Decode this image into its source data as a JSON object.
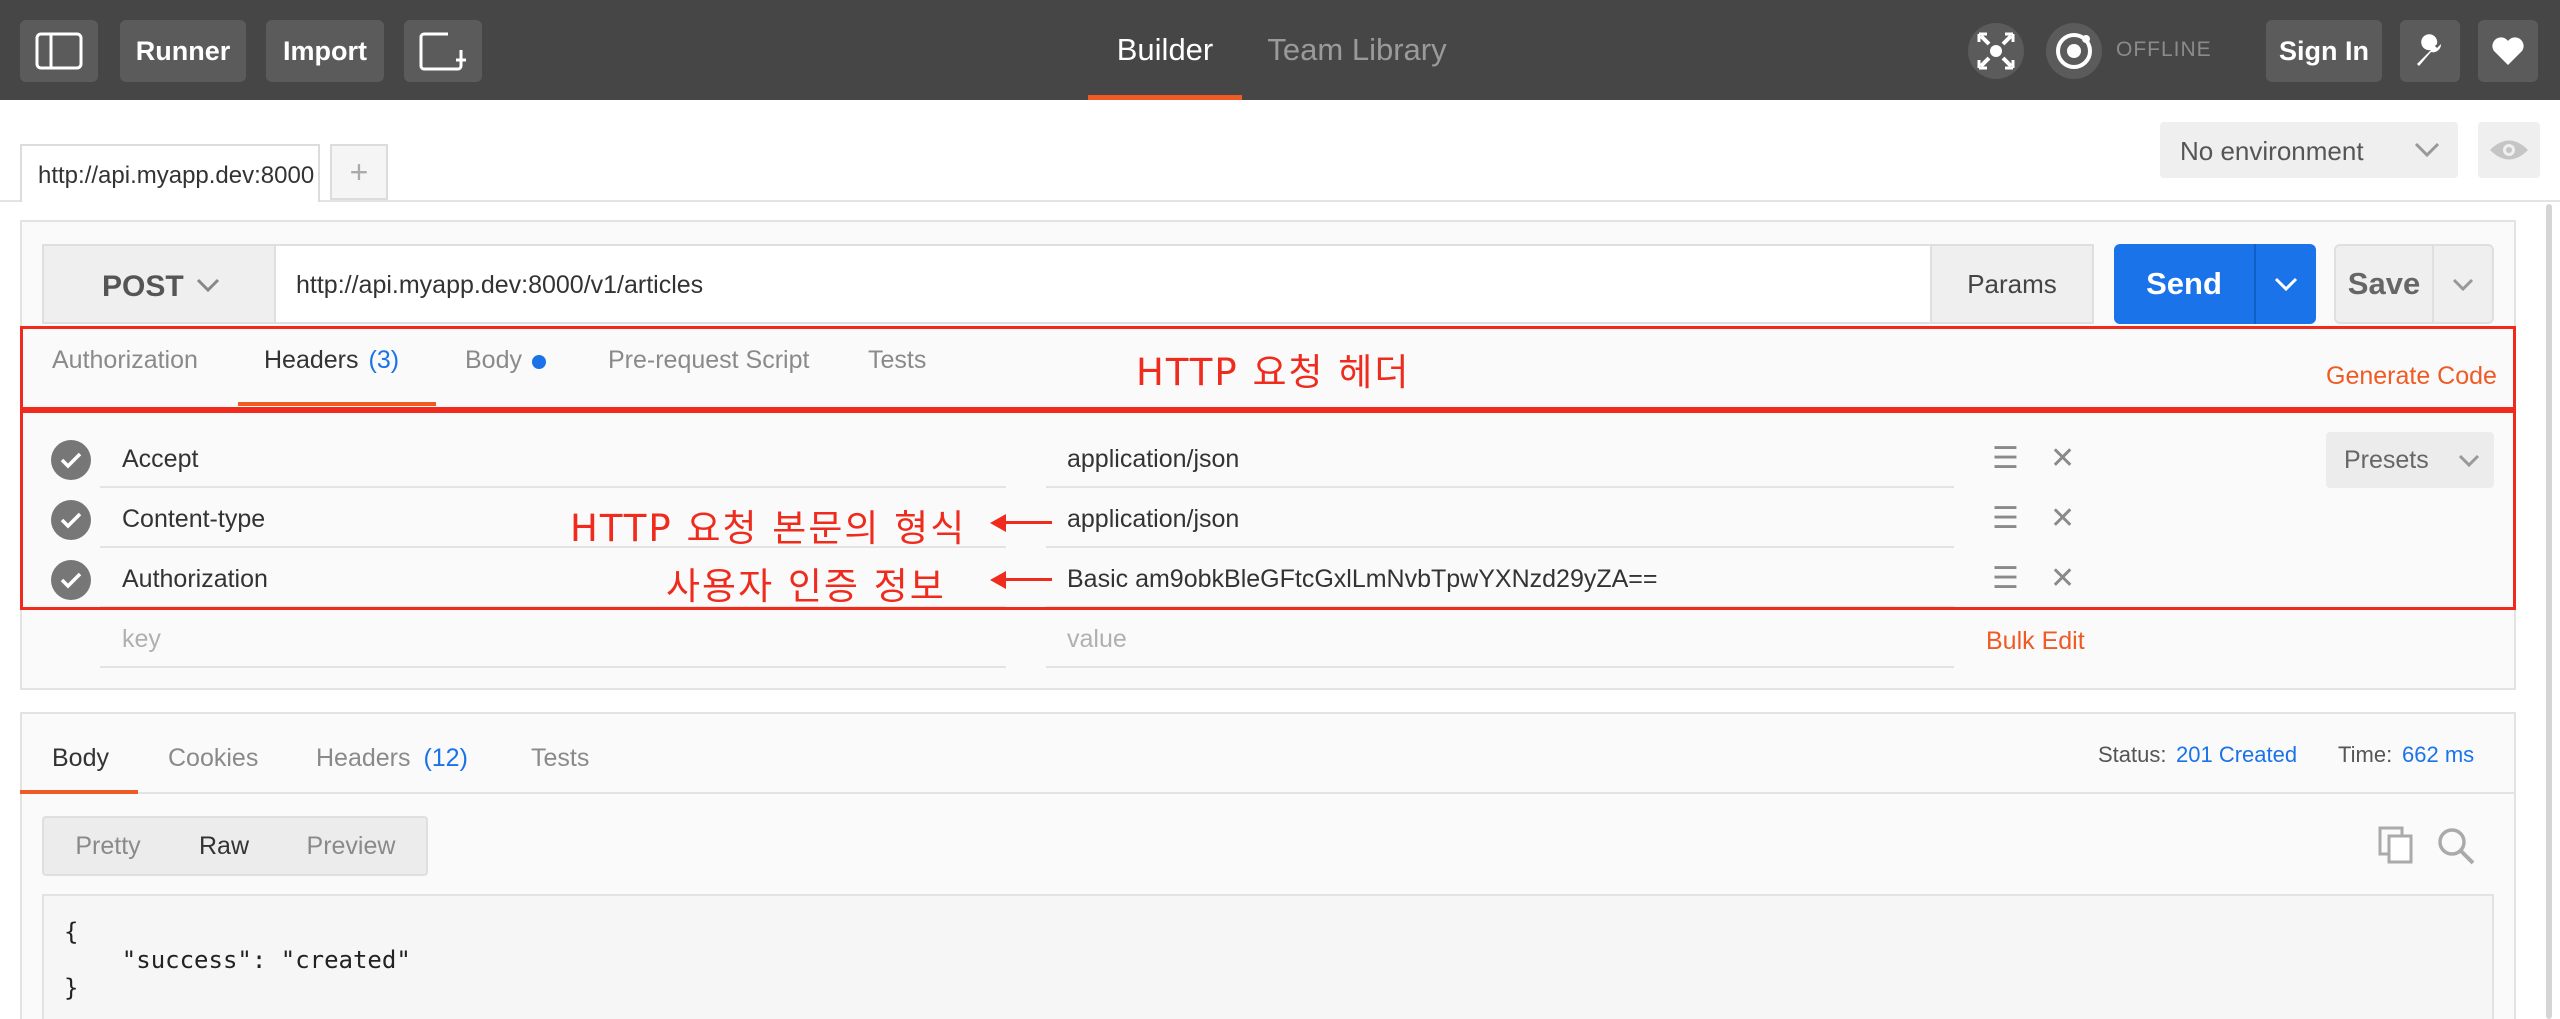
{
  "topbar": {
    "runner": "Runner",
    "import": "Import",
    "nav_builder": "Builder",
    "nav_team_library": "Team Library",
    "offline": "OFFLINE",
    "sign_in": "Sign In",
    "accent_color": "#ef5b25"
  },
  "tabs": {
    "request_tab": "http://api.myapp.dev:8000",
    "add_tab": "+"
  },
  "environment": {
    "selected": "No environment"
  },
  "request": {
    "method": "POST",
    "url": "http://api.myapp.dev:8000/v1/articles",
    "params": "Params",
    "send": "Send",
    "save": "Save",
    "send_color": "#1a73e8"
  },
  "request_tabs": {
    "authorization": "Authorization",
    "headers": "Headers",
    "headers_count": "(3)",
    "body": "Body",
    "pre_request": "Pre-request Script",
    "tests": "Tests",
    "generate_code": "Generate Code"
  },
  "headers": [
    {
      "key": "Accept",
      "value": "application/json"
    },
    {
      "key": "Content-type",
      "value": "application/json"
    },
    {
      "key": "Authorization",
      "value": "Basic am9obkBleGFtcGxlLmNvbTpwYXNzd29yZA=="
    }
  ],
  "header_placeholder": {
    "key": "key",
    "value": "value"
  },
  "bulk_edit": "Bulk Edit",
  "presets": "Presets",
  "annotations": {
    "http_headers": "HTTP 요청 헤더",
    "body_format": "HTTP 요청 본문의 형식",
    "auth_info": "사용자 인증 정보",
    "color": "#ef2b1e"
  },
  "response": {
    "tabs": {
      "body": "Body",
      "cookies": "Cookies",
      "headers": "Headers",
      "headers_count": "(12)",
      "tests": "Tests"
    },
    "status_label": "Status:",
    "status_value": "201 Created",
    "time_label": "Time:",
    "time_value": "662 ms",
    "view_modes": {
      "pretty": "Pretty",
      "raw": "Raw",
      "preview": "Preview"
    },
    "body_lines": [
      "{",
      "    \"success\": \"created\"",
      "}"
    ]
  }
}
